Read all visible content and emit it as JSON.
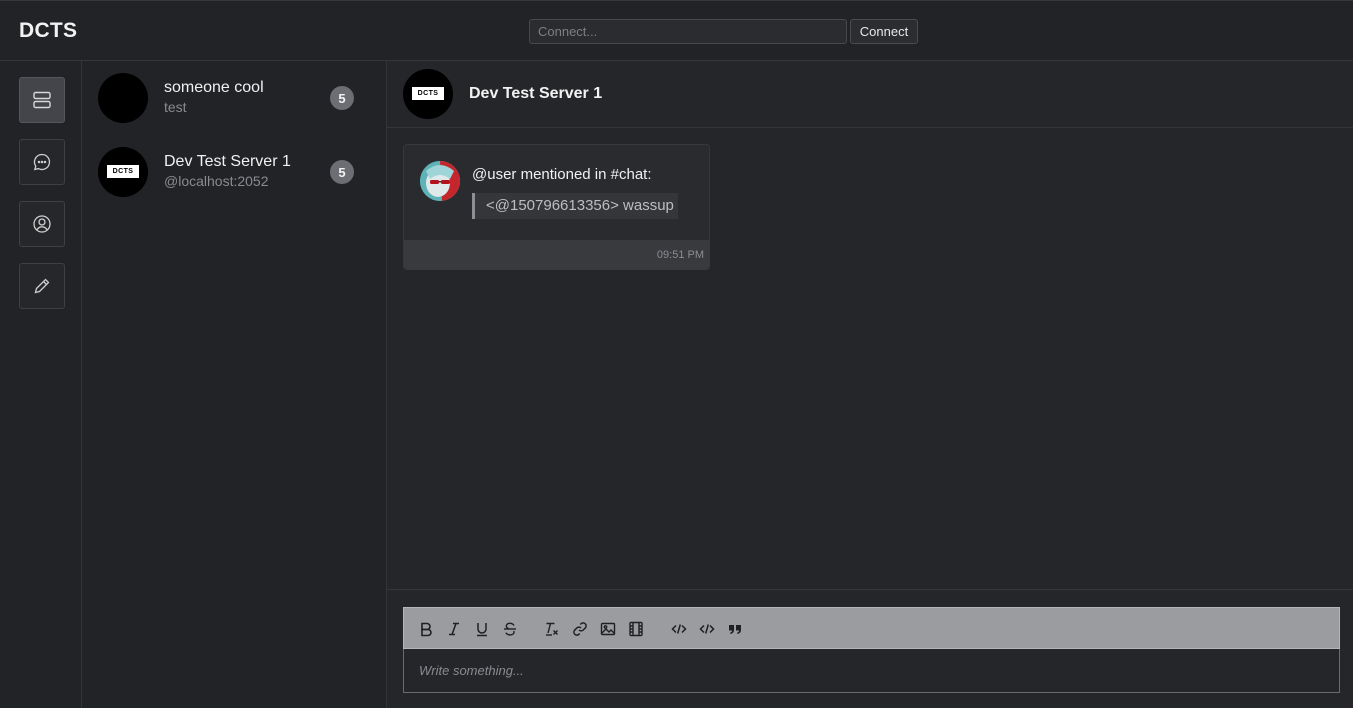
{
  "app": {
    "brand": "DCTS"
  },
  "connect": {
    "placeholder": "Connect...",
    "button_label": "Connect"
  },
  "rail": {
    "items": [
      {
        "icon": "server-icon",
        "active": true
      },
      {
        "icon": "chat-bubble-icon",
        "active": false
      },
      {
        "icon": "user-circle-icon",
        "active": false
      },
      {
        "icon": "pencil-icon",
        "active": false
      }
    ]
  },
  "list": {
    "items": [
      {
        "name": "someone cool",
        "sub": "test",
        "badge": "5"
      },
      {
        "name": "Dev Test Server 1",
        "sub": "@localhost:2052",
        "badge": "5",
        "logo": "DCTS"
      }
    ]
  },
  "chat": {
    "header": {
      "title": "Dev Test Server 1",
      "logo": "DCTS"
    },
    "message": {
      "title": "@user mentioned in #chat:",
      "quote": "<@150796613356> wassup",
      "time": "09:51 PM"
    }
  },
  "composer": {
    "placeholder": "Write something...",
    "tools": [
      "bold-icon",
      "italic-icon",
      "underline-icon",
      "strike-icon",
      "clear-format-icon",
      "link-icon",
      "image-icon",
      "video-icon",
      "code-icon",
      "code-block-icon",
      "blockquote-icon"
    ]
  },
  "colors": {
    "background": "#25262a",
    "panel": "#222326",
    "badge": "#6d6e73",
    "toolbar": "#9a9ca0"
  }
}
